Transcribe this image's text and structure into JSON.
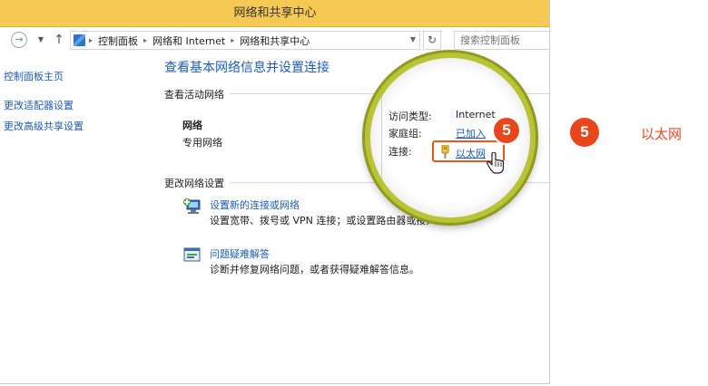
{
  "window": {
    "title": "网络和共享中心"
  },
  "addressbar": {
    "breadcrumbs": [
      "控制面板",
      "网络和 Internet",
      "网络和共享中心"
    ],
    "search_placeholder": "搜索控制面板"
  },
  "sidebar": {
    "items": [
      {
        "label": "控制面板主页"
      },
      {
        "label": "更改适配器设置"
      },
      {
        "label": "更改高级共享设置"
      }
    ]
  },
  "main": {
    "title": "查看基本网络信息并设置连接",
    "active_networks_heading": "查看活动网络",
    "network": {
      "name": "网络",
      "type": "专用网络"
    },
    "change_settings_heading": "更改网络设置",
    "tasks": [
      {
        "label": "设置新的连接或网络",
        "description": "设置宽带、拨号或 VPN 连接；或设置路由器或接入点。",
        "icon": "network-setup-icon"
      },
      {
        "label": "问题疑难解答",
        "description": "诊断并修复网络问题，或者获得疑难解答信息。",
        "icon": "troubleshoot-icon"
      }
    ]
  },
  "magnified": {
    "access_type_label": "访问类型:",
    "access_type_value": "Internet",
    "homegroup_label": "家庭组:",
    "homegroup_value": "已加入",
    "connections_label": "连接:",
    "connection_value": "以太网"
  },
  "callout": {
    "step_number": "5",
    "step_text": "以太网",
    "accent_color": "#e8471c",
    "titlebar_color": "#f6c955"
  }
}
